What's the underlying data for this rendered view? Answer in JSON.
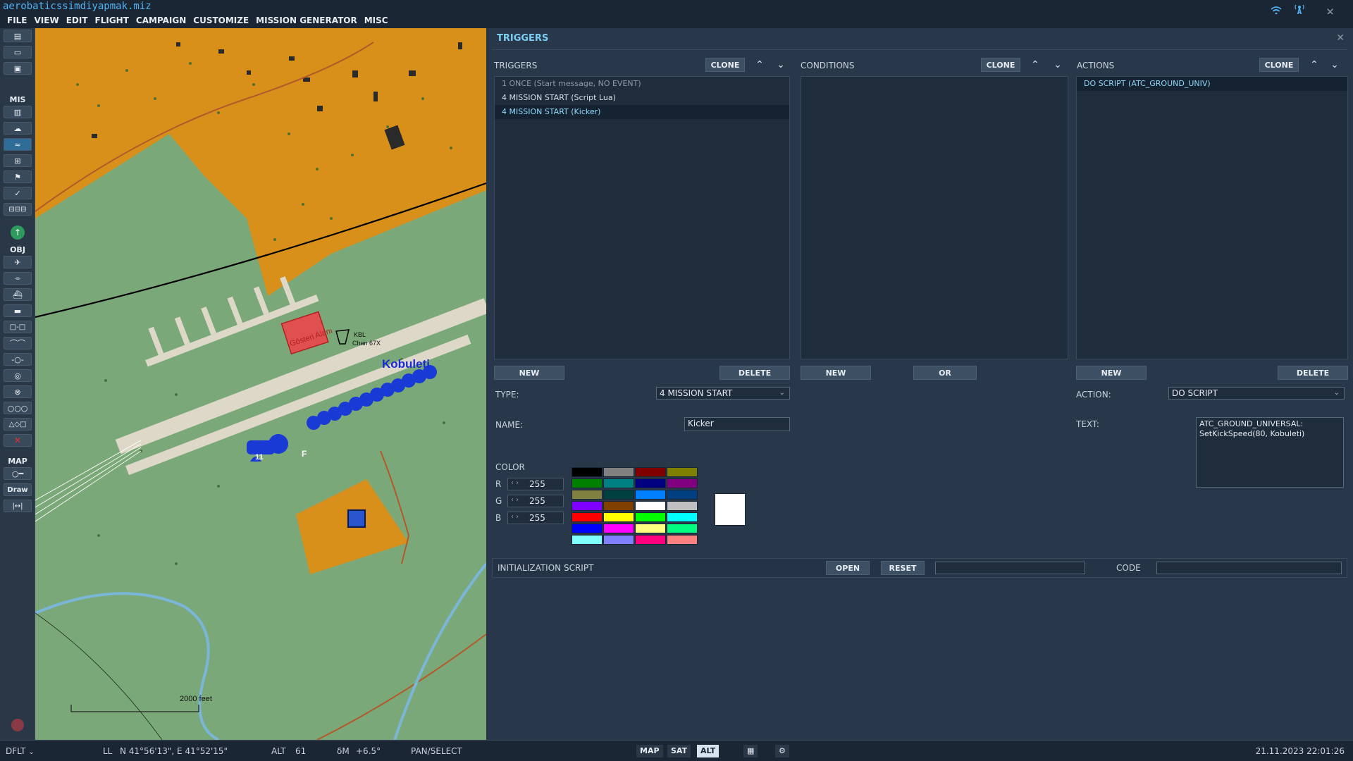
{
  "window": {
    "title": "aerobaticssimdiyapmak.miz"
  },
  "menu": [
    "FILE",
    "VIEW",
    "EDIT",
    "FLIGHT",
    "CAMPAIGN",
    "CUSTOMIZE",
    "MISSION GENERATOR",
    "MISC"
  ],
  "toolbar": {
    "section_mis": "MIS",
    "section_obj": "OBJ",
    "section_map": "MAP",
    "draw_label": "Draw"
  },
  "map": {
    "airfield_name": "Kobuleti",
    "airfield_code": "KBL",
    "airfield_channel": "Chan 67X",
    "zone_label": "Gösteri Alanı",
    "scale_label": "2000 feet",
    "parking_label": "F",
    "parking_number": "11"
  },
  "panel": {
    "title": "TRIGGERS",
    "triggers": {
      "label": "TRIGGERS",
      "clone": "CLONE",
      "items": [
        "1 ONCE (Start message, NO EVENT)",
        "4 MISSION START (Script Lua)",
        "4 MISSION START (Kicker)"
      ],
      "new": "NEW",
      "delete": "DELETE"
    },
    "conditions": {
      "label": "CONDITIONS",
      "clone": "CLONE",
      "new": "NEW",
      "or": "OR"
    },
    "actions": {
      "label": "ACTIONS",
      "clone": "CLONE",
      "items": [
        "DO SCRIPT (ATC_GROUND_UNIV)"
      ],
      "new": "NEW",
      "delete": "DELETE"
    },
    "type_label": "TYPE:",
    "type_value": "4 MISSION START",
    "name_label": "NAME:",
    "name_value": "Kicker",
    "action_label": "ACTION:",
    "action_value": "DO SCRIPT",
    "text_label": "TEXT:",
    "text_value": "ATC_GROUND_UNIVERSAL:\nSetKickSpeed(80, Kobuleti)",
    "color": {
      "label": "COLOR",
      "r_label": "R",
      "g_label": "G",
      "b_label": "B",
      "r": "255",
      "g": "255",
      "b": "255",
      "preview": "#ffffff",
      "palette": [
        "#000000",
        "#808080",
        "#800000",
        "#808000",
        "#008000",
        "#008080",
        "#000080",
        "#800080",
        "#808040",
        "#004040",
        "#0080ff",
        "#004080",
        "#8000ff",
        "#804000",
        "#ffffff",
        "#c0c0c0",
        "#ff0000",
        "#ffff00",
        "#00ff00",
        "#00ffff",
        "#0000ff",
        "#ff00ff",
        "#ffff80",
        "#00ff80",
        "#80ffff",
        "#8080ff",
        "#ff0080",
        "#ff8080"
      ]
    },
    "init_script": {
      "label": "INITIALIZATION SCRIPT",
      "open": "OPEN",
      "reset": "RESET",
      "code_label": "CODE"
    }
  },
  "status": {
    "mode": "DFLT",
    "coord_label": "LL",
    "coords": "N 41°56'13\", E 41°52'15\"",
    "alt_label": "ALT",
    "alt_value": "61",
    "mag_label": "δM",
    "mag_value": "+6.5°",
    "tool": "PAN/SELECT",
    "map_btn": "MAP",
    "sat_btn": "SAT",
    "alt_btn": "ALT",
    "datetime": "21.11.2023 22:01:26"
  }
}
